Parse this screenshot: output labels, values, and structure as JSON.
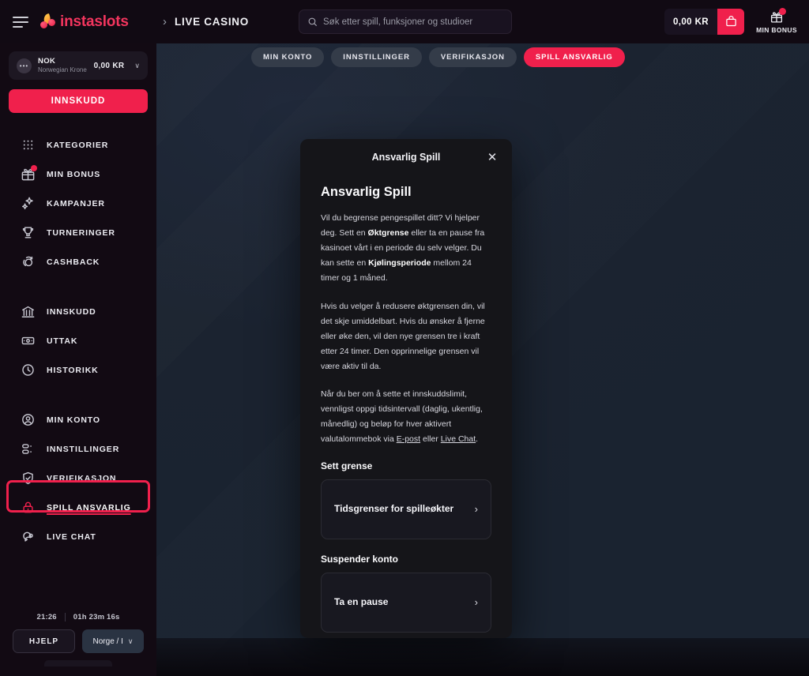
{
  "header": {
    "menu_icon": "hamburger-icon",
    "logo_text": "instaslots",
    "nav_chevron": "›",
    "nav_live_casino": "LIVE CASINO",
    "search_placeholder": "Søk etter spill, funksjoner og studioer",
    "search_value": "",
    "search_icon": "search-icon",
    "balance_amount": "0,00 KR",
    "wallet_icon": "wallet-icon",
    "bonus_icon": "gift-icon",
    "bonus_label": "MIN BONUS",
    "bonus_badge": ""
  },
  "sidebar": {
    "currency": {
      "icon": "coin-icon",
      "code": "NOK",
      "name": "Norwegian Krone",
      "amount": "0,00 KR",
      "chevron": "∨"
    },
    "deposit_label": "INNSKUDD",
    "group1": [
      {
        "icon": "grid-icon",
        "label": "KATEGORIER",
        "badge": false
      },
      {
        "icon": "gift-icon",
        "label": "MIN BONUS",
        "badge": true
      },
      {
        "icon": "sparkle-icon",
        "label": "KAMPANJER",
        "badge": false
      },
      {
        "icon": "trophy-icon",
        "label": "TURNERINGER",
        "badge": false
      },
      {
        "icon": "cashback-icon",
        "label": "CASHBACK",
        "badge": false
      }
    ],
    "group2": [
      {
        "icon": "bank-icon",
        "label": "INNSKUDD"
      },
      {
        "icon": "banknote-icon",
        "label": "UTTAK"
      },
      {
        "icon": "clock-icon",
        "label": "HISTORIKK"
      }
    ],
    "group3": [
      {
        "icon": "user-circle-icon",
        "label": "MIN KONTO",
        "active": false
      },
      {
        "icon": "sliders-icon",
        "label": "INNSTILLINGER",
        "active": false
      },
      {
        "icon": "shield-check-icon",
        "label": "VERIFIKASJON",
        "active": false
      },
      {
        "icon": "lock-icon",
        "label": "SPILL ANSVARLIG",
        "active": true
      },
      {
        "icon": "chat-icon",
        "label": "LIVE CHAT",
        "active": false
      }
    ],
    "footer": {
      "clock_time": "21:26",
      "session_time": "01h 23m 16s",
      "help_label": "HJELP",
      "language_label": "Norge / I",
      "language_chevron": "∨"
    }
  },
  "tabs": [
    {
      "label": "MIN KONTO",
      "active": false
    },
    {
      "label": "INNSTILLINGER",
      "active": false
    },
    {
      "label": "VERIFIKASJON",
      "active": false
    },
    {
      "label": "SPILL ANSVARLIG",
      "active": true
    }
  ],
  "modal": {
    "title": "Ansvarlig Spill",
    "close_icon": "close-icon",
    "heading": "Ansvarlig Spill",
    "paragraph1_a": "Vil du begrense pengespillet ditt? Vi hjelper deg. Sett en ",
    "paragraph1_b": "Øktgrense",
    "paragraph1_c": " eller ta en pause fra kasinoet vårt i en periode du selv velger. Du kan sette en ",
    "paragraph1_d": "Kjølingsperiode",
    "paragraph1_e": " mellom 24 timer og 1 måned.",
    "paragraph2": "Hvis du velger å redusere øktgrensen din, vil det skje umiddelbart. Hvis du ønsker å fjerne eller øke den, vil den nye grensen tre i kraft etter 24 timer. Den opprinnelige grensen vil være aktiv til da.",
    "paragraph3_a": "Når du ber om å sette et innskuddslimit, vennligst oppgi tidsintervall (daglig, ukentlig, månedlig) og beløp for hver aktivert valutalommebok via ",
    "paragraph3_link1": "E-post",
    "paragraph3_b": " eller ",
    "paragraph3_link2": "Live Chat",
    "paragraph3_c": ".",
    "section1_title": "Sett grense",
    "option1_label": "Tidsgrenser for spilleøkter",
    "option1_chevron": "›",
    "section2_title": "Suspender konto",
    "option2_label": "Ta en pause",
    "option2_chevron": "›"
  },
  "colors": {
    "accent": "#f0204c",
    "sidebar_bg": "#120a13",
    "page_bg": "#1c2430",
    "modal_bg": "#151519",
    "tab_bg": "#343c49"
  }
}
